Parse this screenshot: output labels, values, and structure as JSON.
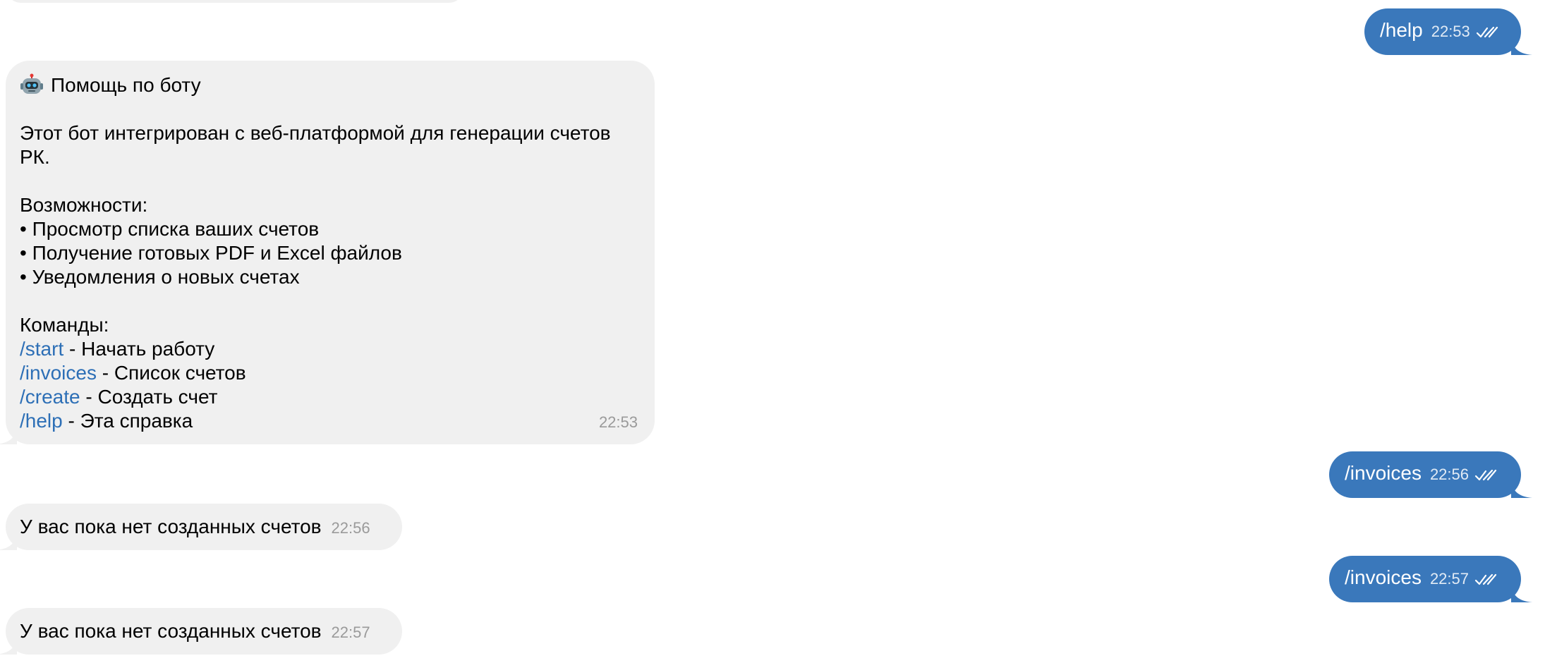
{
  "messages": {
    "m1": {
      "text": "/help",
      "time": "22:53"
    },
    "m2": {
      "title": "Помощь по боту",
      "intro_line1": "Этот бот интегрирован с веб-платформой для генерации счетов",
      "intro_line2": "РК.",
      "features_header": "Возможности:",
      "features": [
        "• Просмотр списка ваших счетов",
        "• Получение готовых PDF и Excel файлов",
        "• Уведомления о новых счетах"
      ],
      "commands_header": "Команды:",
      "commands": [
        {
          "cmd": "/start",
          "desc": " - Начать работу"
        },
        {
          "cmd": "/invoices",
          "desc": " - Список счетов"
        },
        {
          "cmd": "/create",
          "desc": " - Создать счет"
        },
        {
          "cmd": "/help",
          "desc": " - Эта справка"
        }
      ],
      "time": "22:53"
    },
    "m3": {
      "text": "/invoices",
      "time": "22:56"
    },
    "m4": {
      "text": "У вас пока нет созданных счетов",
      "time": "22:56"
    },
    "m5": {
      "text": "/invoices",
      "time": "22:57"
    },
    "m6": {
      "text": "У вас пока нет созданных счетов",
      "time": "22:57"
    }
  },
  "colors": {
    "outgoing_bubble": "#3a78bb",
    "incoming_bubble": "#f0f0f0",
    "command_link": "#2d6fb6"
  },
  "icons": {
    "read_status": "double-check-icon",
    "bot": "robot-icon"
  }
}
